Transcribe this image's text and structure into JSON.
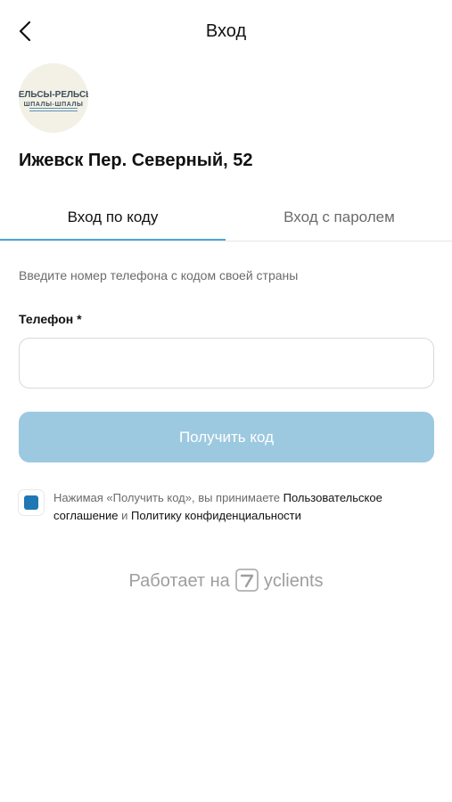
{
  "header": {
    "title": "Вход"
  },
  "branch": {
    "name": "Ижевск Пер. Северный, 52"
  },
  "logo": {
    "line1": "РЕЛЬСЫ-РЕЛЬСЫ",
    "line2": "ШПАЛЫ-ШПАЛЫ"
  },
  "tabs": [
    {
      "label": "Вход по коду",
      "active": true
    },
    {
      "label": "Вход с паролем",
      "active": false
    }
  ],
  "form": {
    "hint": "Введите номер телефона с кодом своей страны",
    "phone_label": "Телефон *",
    "phone_value": "",
    "phone_placeholder": "",
    "submit_label": "Получить код"
  },
  "consent": {
    "checked": true,
    "prefix": "Нажимая «Получить код», вы принимаете ",
    "terms_link": "Пользовательское соглашение",
    "middle": " и ",
    "privacy_link": "Политику конфиденциальности"
  },
  "footer": {
    "powered_prefix": "Работает на",
    "brand": "yclients"
  },
  "colors": {
    "accent": "#4fa7d0",
    "button_disabled": "#9dc9e0",
    "checkbox": "#1f77b4"
  },
  "icons": {
    "back": "chevron-left-icon",
    "brand": "yclients-logo-icon"
  }
}
